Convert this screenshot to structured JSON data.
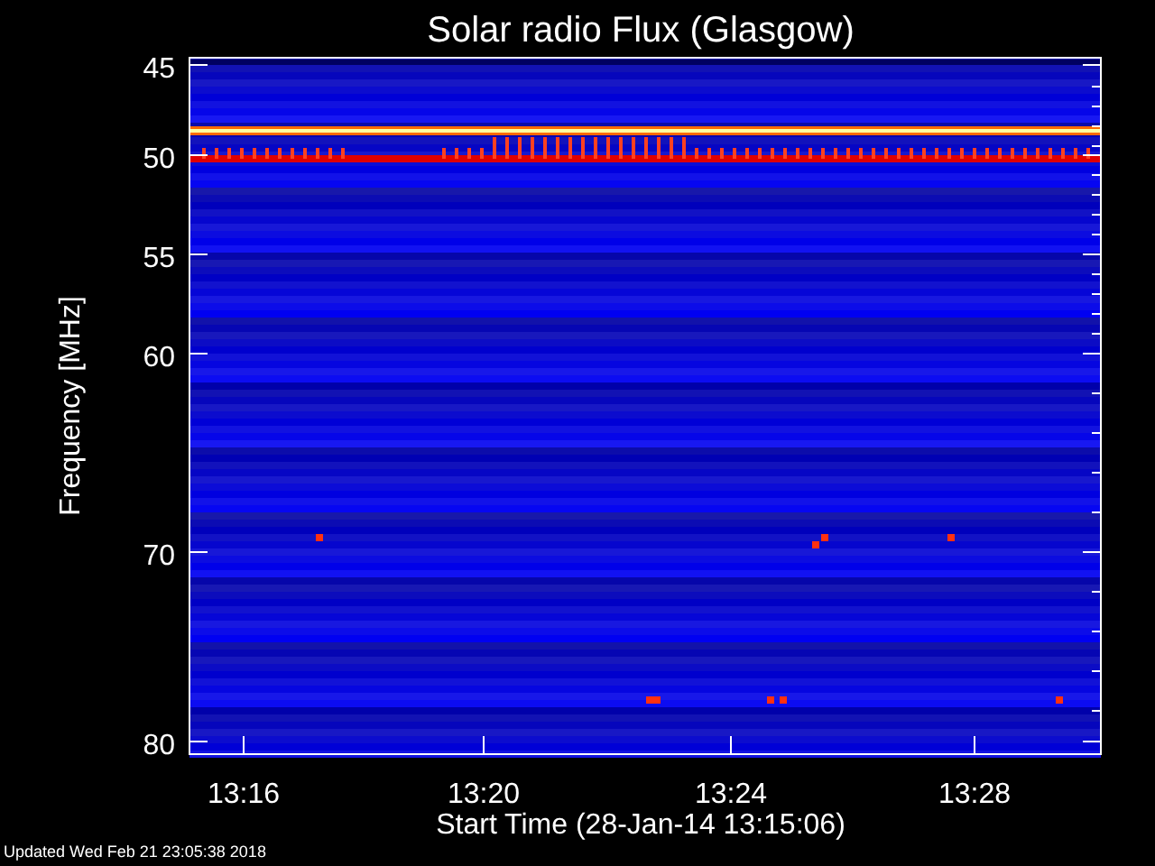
{
  "chart": {
    "title": "Solar radio Flux (Glasgow)",
    "y_axis": {
      "label": "Frequency [MHz]",
      "ticks": [
        "45",
        "50",
        "55",
        "60",
        "70",
        "80"
      ]
    },
    "x_axis": {
      "label": "Start Time (28-Jan-14 13:15:06)",
      "ticks": [
        "13:16",
        "13:20",
        "13:24",
        "13:28"
      ]
    }
  },
  "footer": "Updated Wed Feb 21 23:05:38 2018"
}
